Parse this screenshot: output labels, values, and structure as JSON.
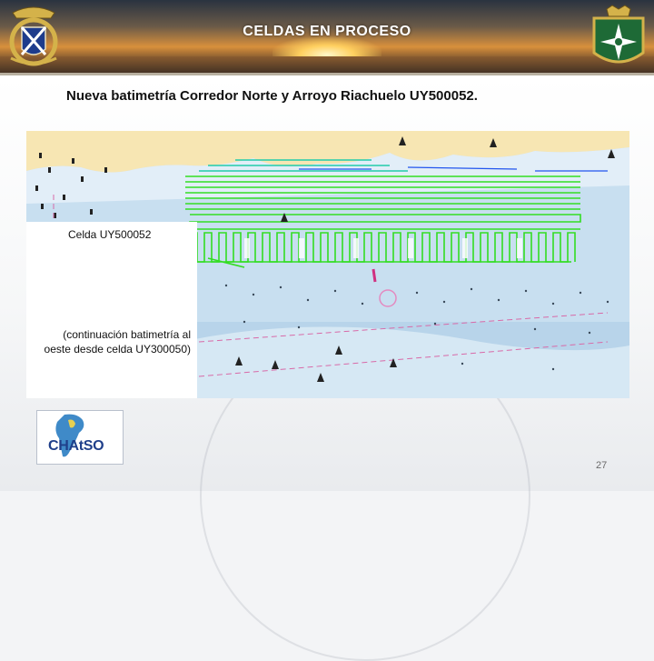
{
  "header": {
    "title": "CELDAS EN PROCESO"
  },
  "slide": {
    "subtitle": "Nueva batimetría Corredor Norte y Arroyo Riachuelo UY500052.",
    "cell_label": "Celda UY500052",
    "continuation_label": "(continuación batimetría al oeste desde celda UY300050)",
    "page_number": "27"
  },
  "logo": {
    "text": "CHAtSO"
  },
  "colors": {
    "land": "#f7e6b3",
    "water": "#c8dff0",
    "survey_green": "#33dd22",
    "survey_cyan": "#22ccaa",
    "survey_blue": "#2255ee"
  }
}
